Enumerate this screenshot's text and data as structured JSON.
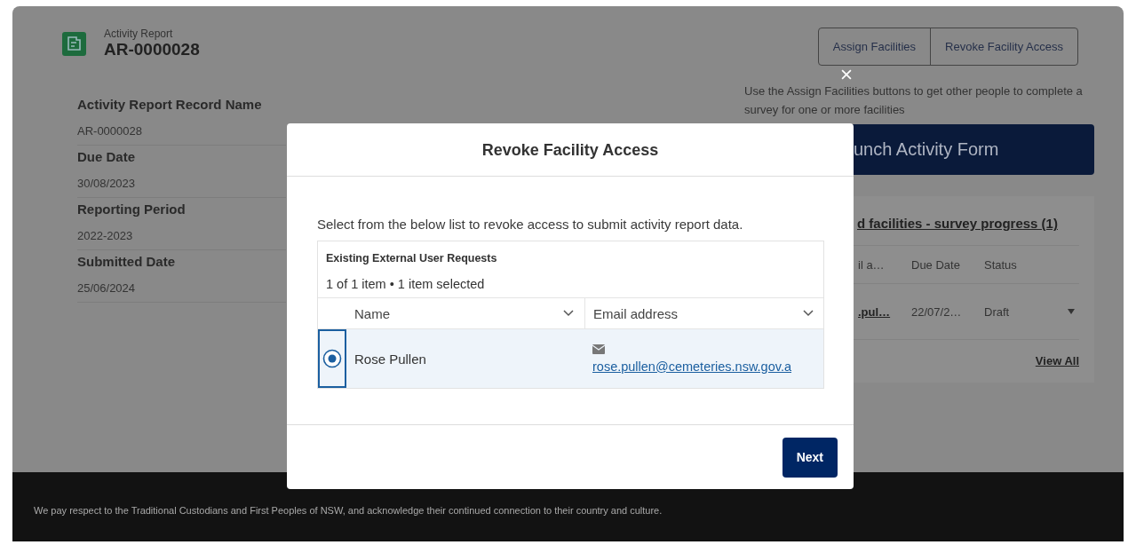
{
  "record": {
    "type_label": "Activity Report",
    "title": "AR-0000028"
  },
  "fields": [
    {
      "label": "Activity Report Record Name",
      "value": "AR-0000028"
    },
    {
      "label": "Due Date",
      "value": "30/08/2023"
    },
    {
      "label": "Reporting Period",
      "value": "2022-2023"
    },
    {
      "label": "Submitted Date",
      "value": "25/06/2024"
    }
  ],
  "actions": [
    "Assign Facilities",
    "Revoke Facility Access"
  ],
  "help_text": "Use the Assign Facilities buttons to get other people to complete a survey for one or more facilities",
  "launch_button": "unch Activity Form",
  "survey_card": {
    "title": "d facilities - survey progress (1)",
    "columns": [
      "il a…",
      "Due Date",
      "Status"
    ],
    "rows": [
      {
        "email": ".pul…",
        "due_date": "22/07/2…",
        "status": "Draft"
      }
    ],
    "view_all": "View All"
  },
  "modal": {
    "title": "Revoke Facility Access",
    "instructions": "Select from the below list to revoke access to submit activity report data.",
    "table": {
      "title": "Existing External User Requests",
      "summary": "1 of 1 item • 1 item selected",
      "columns": [
        "Name",
        "Email address"
      ],
      "rows": [
        {
          "selected": true,
          "name": "Rose Pullen",
          "email": "rose.pullen@cemeteries.nsw.gov.a"
        }
      ]
    },
    "buttons": [
      "Next"
    ]
  },
  "footer": "We pay respect to the Traditional Custodians and First Peoples of NSW, and acknowledge their continued connection to their country and culture."
}
